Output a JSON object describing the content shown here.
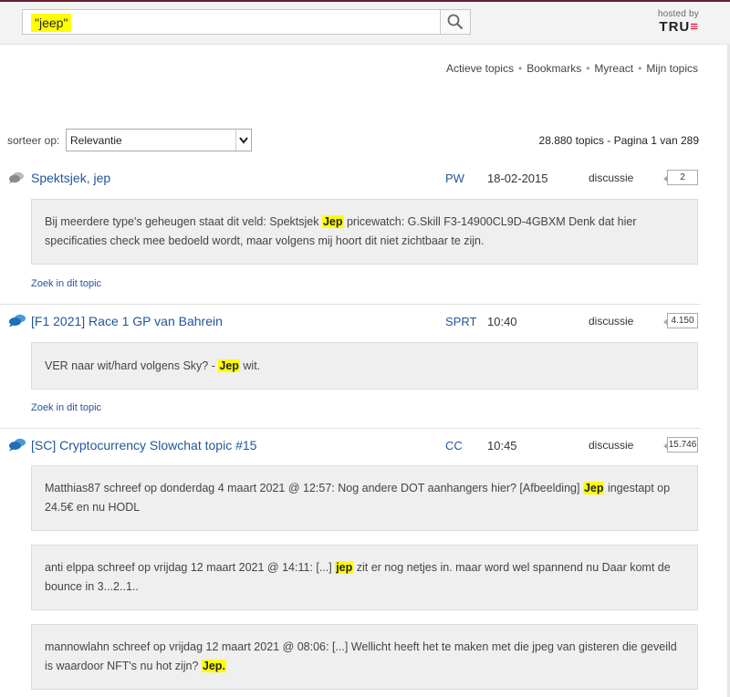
{
  "search": {
    "query": "\"jeep\""
  },
  "hosted": {
    "label": "hosted by",
    "logo_main": "TRU",
    "logo_accent": "≡"
  },
  "nav": [
    "Actieve topics",
    "Bookmarks",
    "Myreact",
    "Mijn topics"
  ],
  "sort": {
    "label": "sorteer op:",
    "selected": "Relevantie"
  },
  "results_count": "28.880 topics - Pagina 1 van 289",
  "topics": [
    {
      "title": "Spektsjek, jep",
      "category": "PW",
      "date": "18-02-2015",
      "type": "discussie",
      "replies": "2",
      "snippets": [
        {
          "before": "Bij meerdere type's geheugen staat dit veld: Spektsjek ",
          "highlight": "Jep",
          "after": " pricewatch: G.Skill F3-14900CL9D-4GBXM Denk dat hier specificaties check mee bedoeld wordt, maar volgens mij hoort dit niet zichtbaar te zijn."
        }
      ],
      "search_in_topic": "Zoek in dit topic"
    },
    {
      "title": "[F1 2021] Race 1 GP van Bahrein",
      "category": "SPRT",
      "date": "10:40",
      "type": "discussie",
      "replies": "4.150",
      "snippets": [
        {
          "before": "VER naar wit/hard volgens Sky? - ",
          "highlight": "Jep",
          "after": " wit."
        }
      ],
      "search_in_topic": "Zoek in dit topic"
    },
    {
      "title": "[SC] Cryptocurrency Slowchat topic #15",
      "category": "CC",
      "date": "10:45",
      "type": "discussie",
      "replies": "15.746",
      "snippets": [
        {
          "before": "Matthias87 schreef op donderdag 4 maart 2021 @ 12:57: Nog andere DOT aanhangers hier? [Afbeelding] ",
          "highlight": "Jep",
          "after": " ingestapt op 24.5€ en nu HODL"
        },
        {
          "before": "anti elppa schreef op vrijdag 12 maart 2021 @ 14:11: [...] ",
          "highlight": "jep",
          "after": " zit er nog netjes in. maar word wel spannend nu Daar komt de bounce in 3...2..1.."
        },
        {
          "before": "mannowlahn schreef op vrijdag 12 maart 2021 @ 08:06: [...] Wellicht heeft het te maken met die jpeg van gisteren die geveild is waardoor NFT's nu hot zijn? ",
          "highlight": "Jep.",
          "after": ""
        }
      ]
    }
  ],
  "colors": {
    "link": "#22569a",
    "highlight": "#ffff00",
    "snippet_bg": "#efefef",
    "brand_red": "#e4002b"
  },
  "icons": {
    "search": "magnifier-icon",
    "single_topic": "chat-bubble-gray-icon",
    "active_topic": "chat-bubbles-blue-icon",
    "dropdown": "chevron-down-icon"
  }
}
